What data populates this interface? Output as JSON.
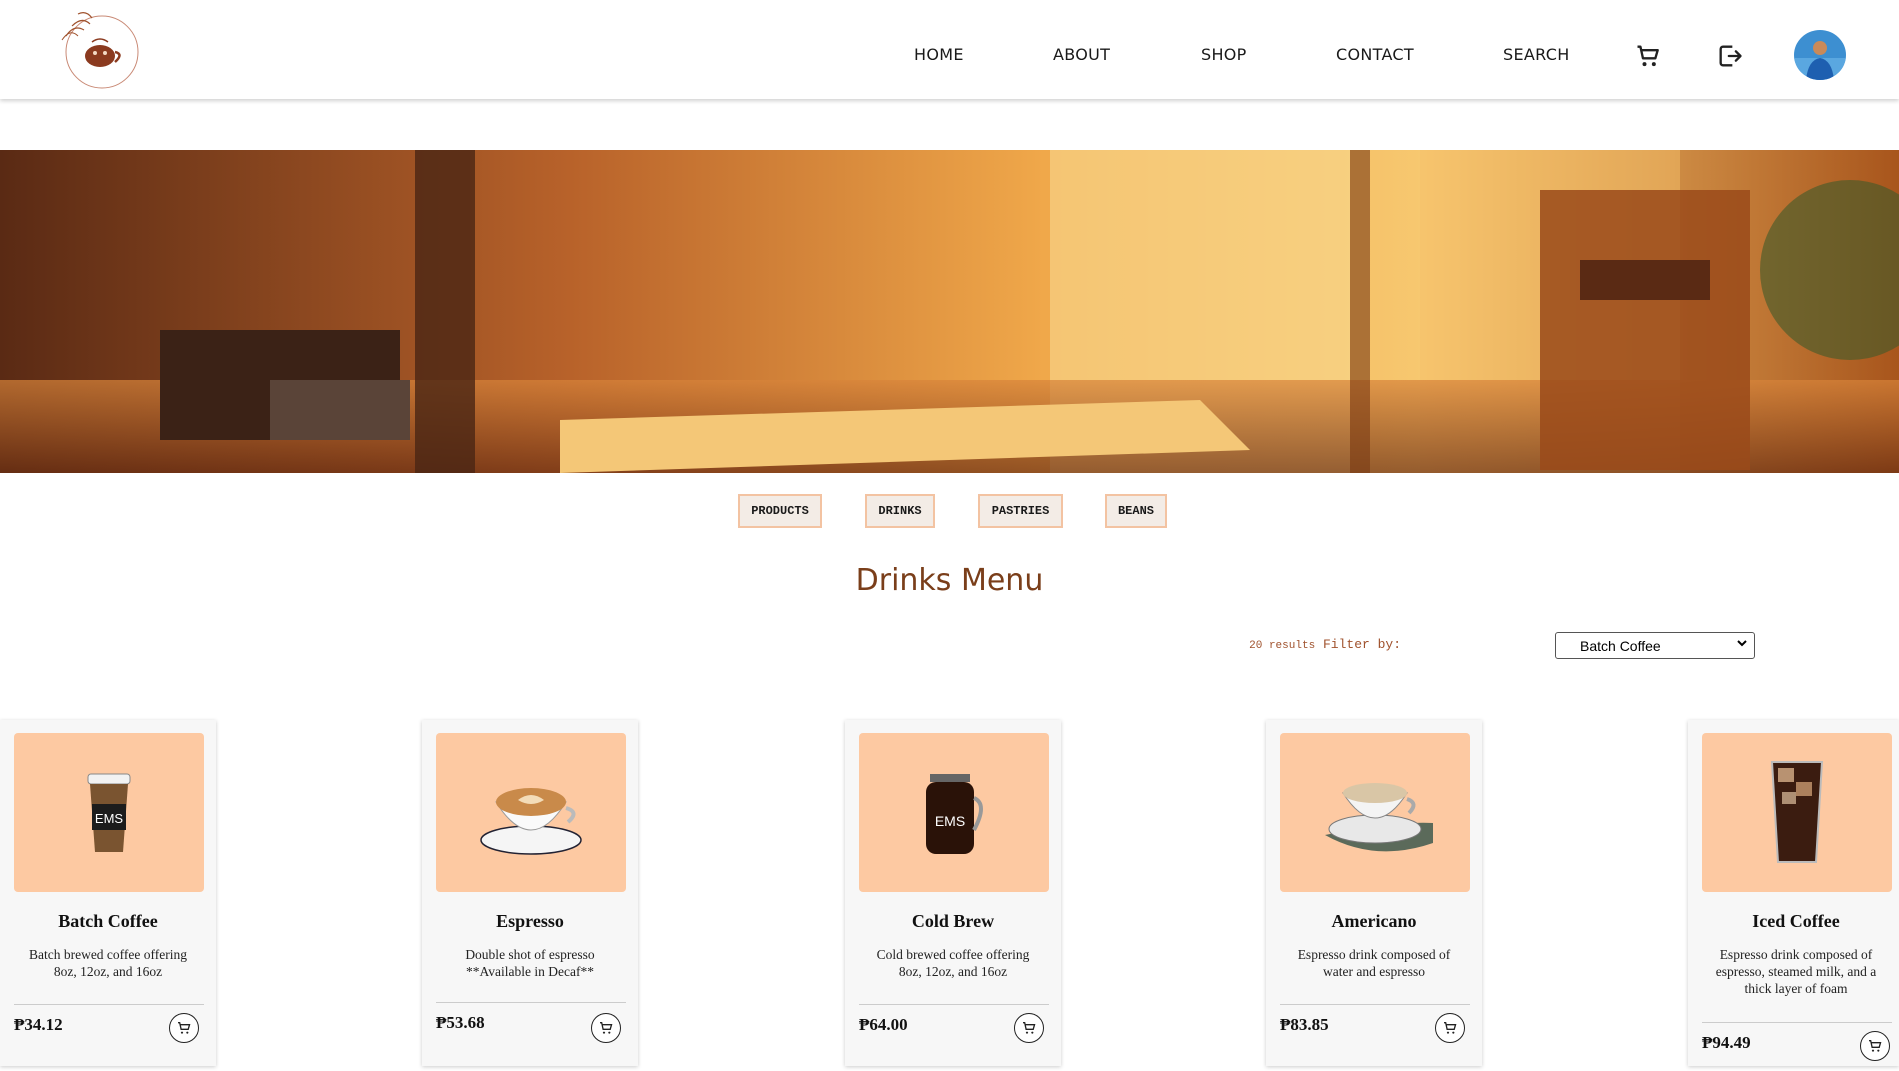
{
  "nav": {
    "home": "HOME",
    "about": "ABOUT",
    "shop": "SHOP",
    "contact": "CONTACT",
    "search": "SEARCH"
  },
  "icons": {
    "logo": "coffee-shop-logo",
    "cart": "cart-icon",
    "logout": "logout-icon",
    "avatar": "user-avatar"
  },
  "categories": [
    "PRODUCTS",
    "DRINKS",
    "PASTRIES",
    "BEANS"
  ],
  "menu": {
    "title": "Drinks Menu",
    "results_count": "20 results",
    "filter_label": "Filter by:",
    "filter_value": "Batch Coffee"
  },
  "products": [
    {
      "name": "Batch Coffee",
      "desc_line1": "Batch brewed coffee offering",
      "desc_line2": "8oz, 12oz, and 16oz",
      "desc_line3": "",
      "price": "₱34.12",
      "image": "paper-cup-icon"
    },
    {
      "name": "Espresso",
      "desc_line1": "Double shot of espresso",
      "desc_line2": "**Available in Decaf**",
      "desc_line3": "",
      "price": "₱53.68",
      "image": "latte-cup-icon"
    },
    {
      "name": "Cold Brew",
      "desc_line1": "Cold brewed coffee offering",
      "desc_line2": "8oz, 12oz, and 16oz",
      "desc_line3": "",
      "price": "₱64.00",
      "image": "mason-jar-icon"
    },
    {
      "name": "Americano",
      "desc_line1": "Espresso drink composed of",
      "desc_line2": "water and espresso",
      "desc_line3": "",
      "price": "₱83.85",
      "image": "coffee-cup-saucer-icon"
    },
    {
      "name": "Iced Coffee",
      "desc_line1": "Espresso drink composed of",
      "desc_line2": "espresso, steamed milk, and a",
      "desc_line3": "thick layer of foam",
      "price": "₱94.49",
      "image": "iced-glass-icon"
    }
  ],
  "colors": {
    "accent": "#7a3e1a",
    "card_image_bg": "#fdc9a2",
    "category_border": "#f3c3a2"
  }
}
